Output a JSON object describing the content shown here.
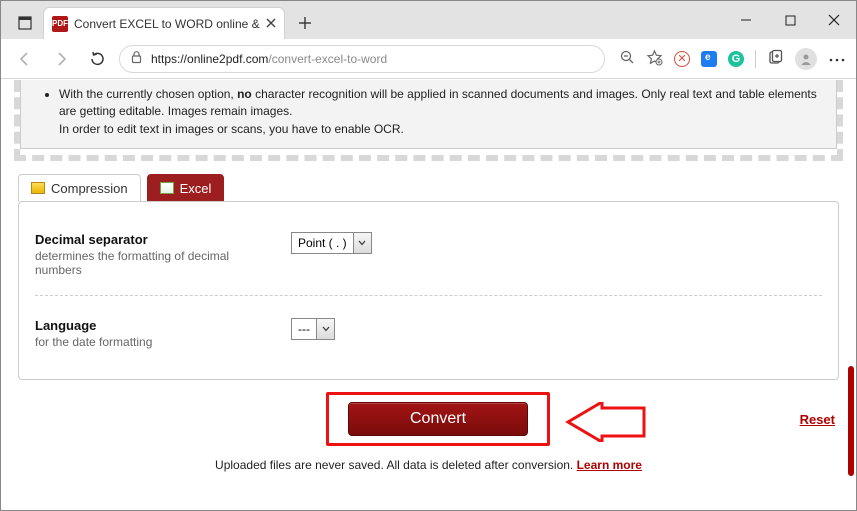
{
  "window": {
    "tab_title": "Convert EXCEL to WORD online &",
    "favicon_text": "PDF",
    "url_host": "online2pdf.com",
    "url_prefix": "https://",
    "url_path": "/convert-excel-to-word"
  },
  "notice": {
    "line1a": "With the currently chosen option, ",
    "line1_bold": "no",
    "line1b": " character recognition will be applied in scanned documents and images. Only real text and table elements are getting editable. Images remain images.",
    "line2": "In order to edit text in images or scans, you have to enable OCR."
  },
  "tabs": {
    "compression": "Compression",
    "excel": "Excel"
  },
  "settings": {
    "decimal": {
      "title": "Decimal separator",
      "sub": "determines the formatting of decimal numbers",
      "value": "Point ( . )"
    },
    "language": {
      "title": "Language",
      "sub": "for the date formatting",
      "value": "---"
    }
  },
  "actions": {
    "convert": "Convert",
    "reset": "Reset"
  },
  "footer": {
    "text": "Uploaded files are never saved. All data is deleted after conversion. ",
    "link": "Learn more"
  }
}
